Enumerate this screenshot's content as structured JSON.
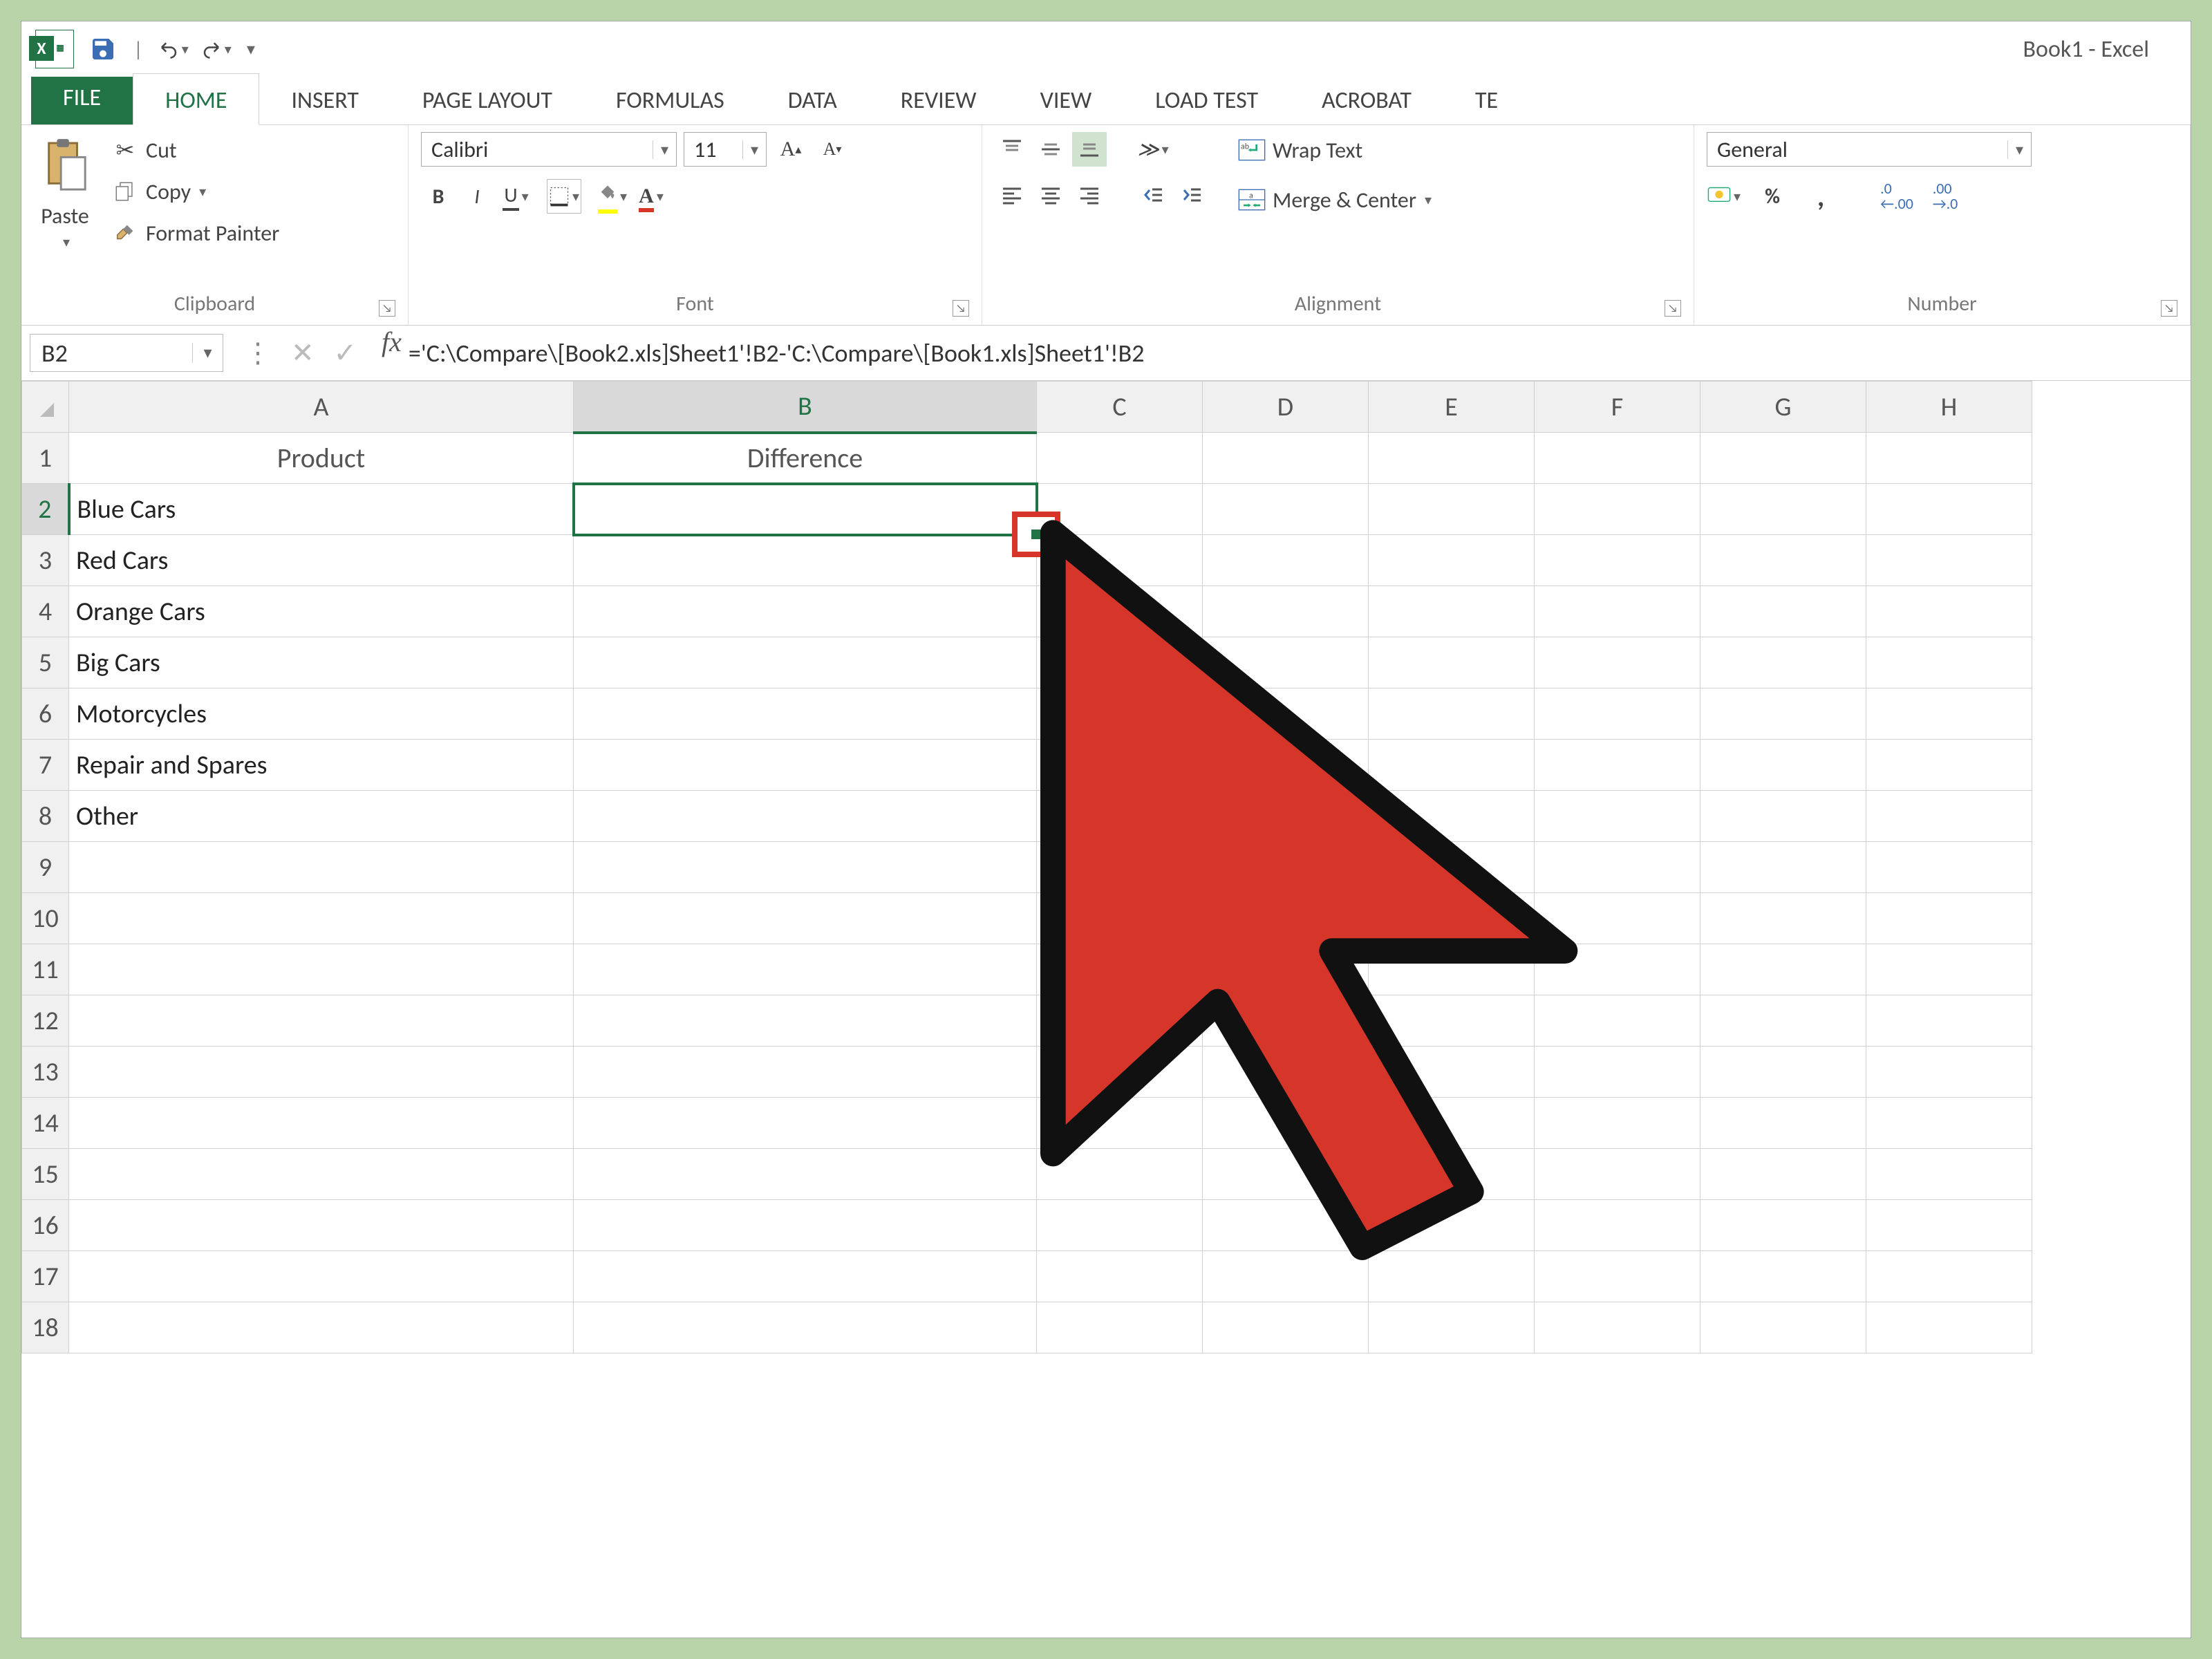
{
  "window": {
    "title": "Book1 - Excel"
  },
  "qat": {
    "save": "💾",
    "undo": "↶",
    "redo": "↷"
  },
  "tabs": {
    "file": "FILE",
    "items": [
      "HOME",
      "INSERT",
      "PAGE LAYOUT",
      "FORMULAS",
      "DATA",
      "REVIEW",
      "VIEW",
      "LOAD TEST",
      "ACROBAT",
      "TE"
    ],
    "active": "HOME"
  },
  "ribbon": {
    "clipboard": {
      "paste": "Paste",
      "cut": "Cut",
      "copy": "Copy",
      "format_painter": "Format Painter",
      "label": "Clipboard"
    },
    "font": {
      "name": "Calibri",
      "size": "11",
      "bold": "B",
      "italic": "I",
      "underline": "U",
      "label": "Font"
    },
    "alignment": {
      "wrap": "Wrap Text",
      "merge": "Merge & Center",
      "label": "Alignment"
    },
    "number": {
      "format": "General",
      "label": "Number"
    }
  },
  "formula_bar": {
    "name_box": "B2",
    "fx": "fx",
    "formula": "='C:\\Compare\\[Book2.xls]Sheet1'!B2-'C:\\Compare\\[Book1.xls]Sheet1'!B2"
  },
  "columns": [
    "A",
    "B",
    "C",
    "D",
    "E",
    "F",
    "G",
    "H"
  ],
  "selected_column": "B",
  "selected_row": 2,
  "row_count": 18,
  "cells": {
    "A1": "Product",
    "B1": "Difference",
    "A2": "Blue Cars",
    "A3": "Red Cars",
    "A4": "Orange Cars",
    "A5": "Big Cars",
    "A6": "Motorcycles",
    "A7": "Repair and Spares",
    "A8": "Other"
  },
  "annotation": {
    "fill_handle_highlight": true
  }
}
